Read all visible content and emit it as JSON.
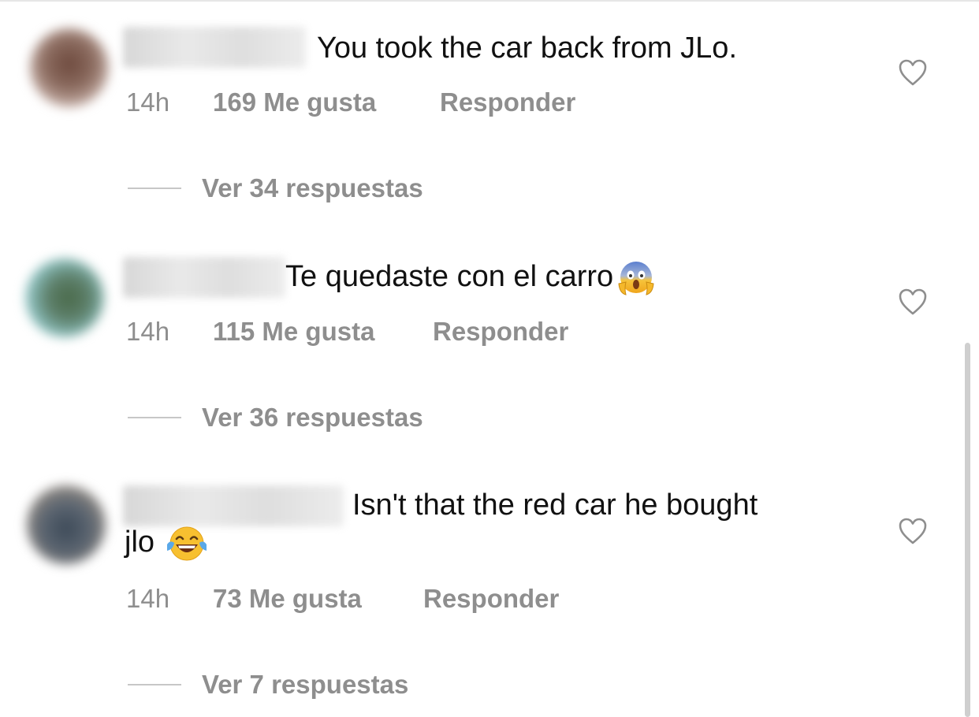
{
  "comments": [
    {
      "text": "You took the car back from JLo.",
      "time": "14h",
      "likes": "169 Me gusta",
      "reply": "Responder",
      "view_replies": "Ver 34 respuestas",
      "emoji": null,
      "icons": {
        "like": "heart-outline-icon"
      }
    },
    {
      "text": "Te quedaste con el carro",
      "time": "14h",
      "likes": "115 Me gusta",
      "reply": "Responder",
      "view_replies": "Ver 36 respuestas",
      "emoji": "screaming-face-emoji",
      "icons": {
        "like": "heart-outline-icon"
      }
    },
    {
      "text": "Isn't that the red car he bought",
      "text_cont": "jlo",
      "time": "14h",
      "likes": "73 Me gusta",
      "reply": "Responder",
      "view_replies": "Ver 7 respuestas",
      "emoji": "tears-of-joy-emoji",
      "icons": {
        "like": "heart-outline-icon"
      }
    }
  ],
  "colors": {
    "text": "#111111",
    "secondary": "#8e8e8e",
    "divider": "#c7c7c7",
    "background": "#ffffff"
  }
}
